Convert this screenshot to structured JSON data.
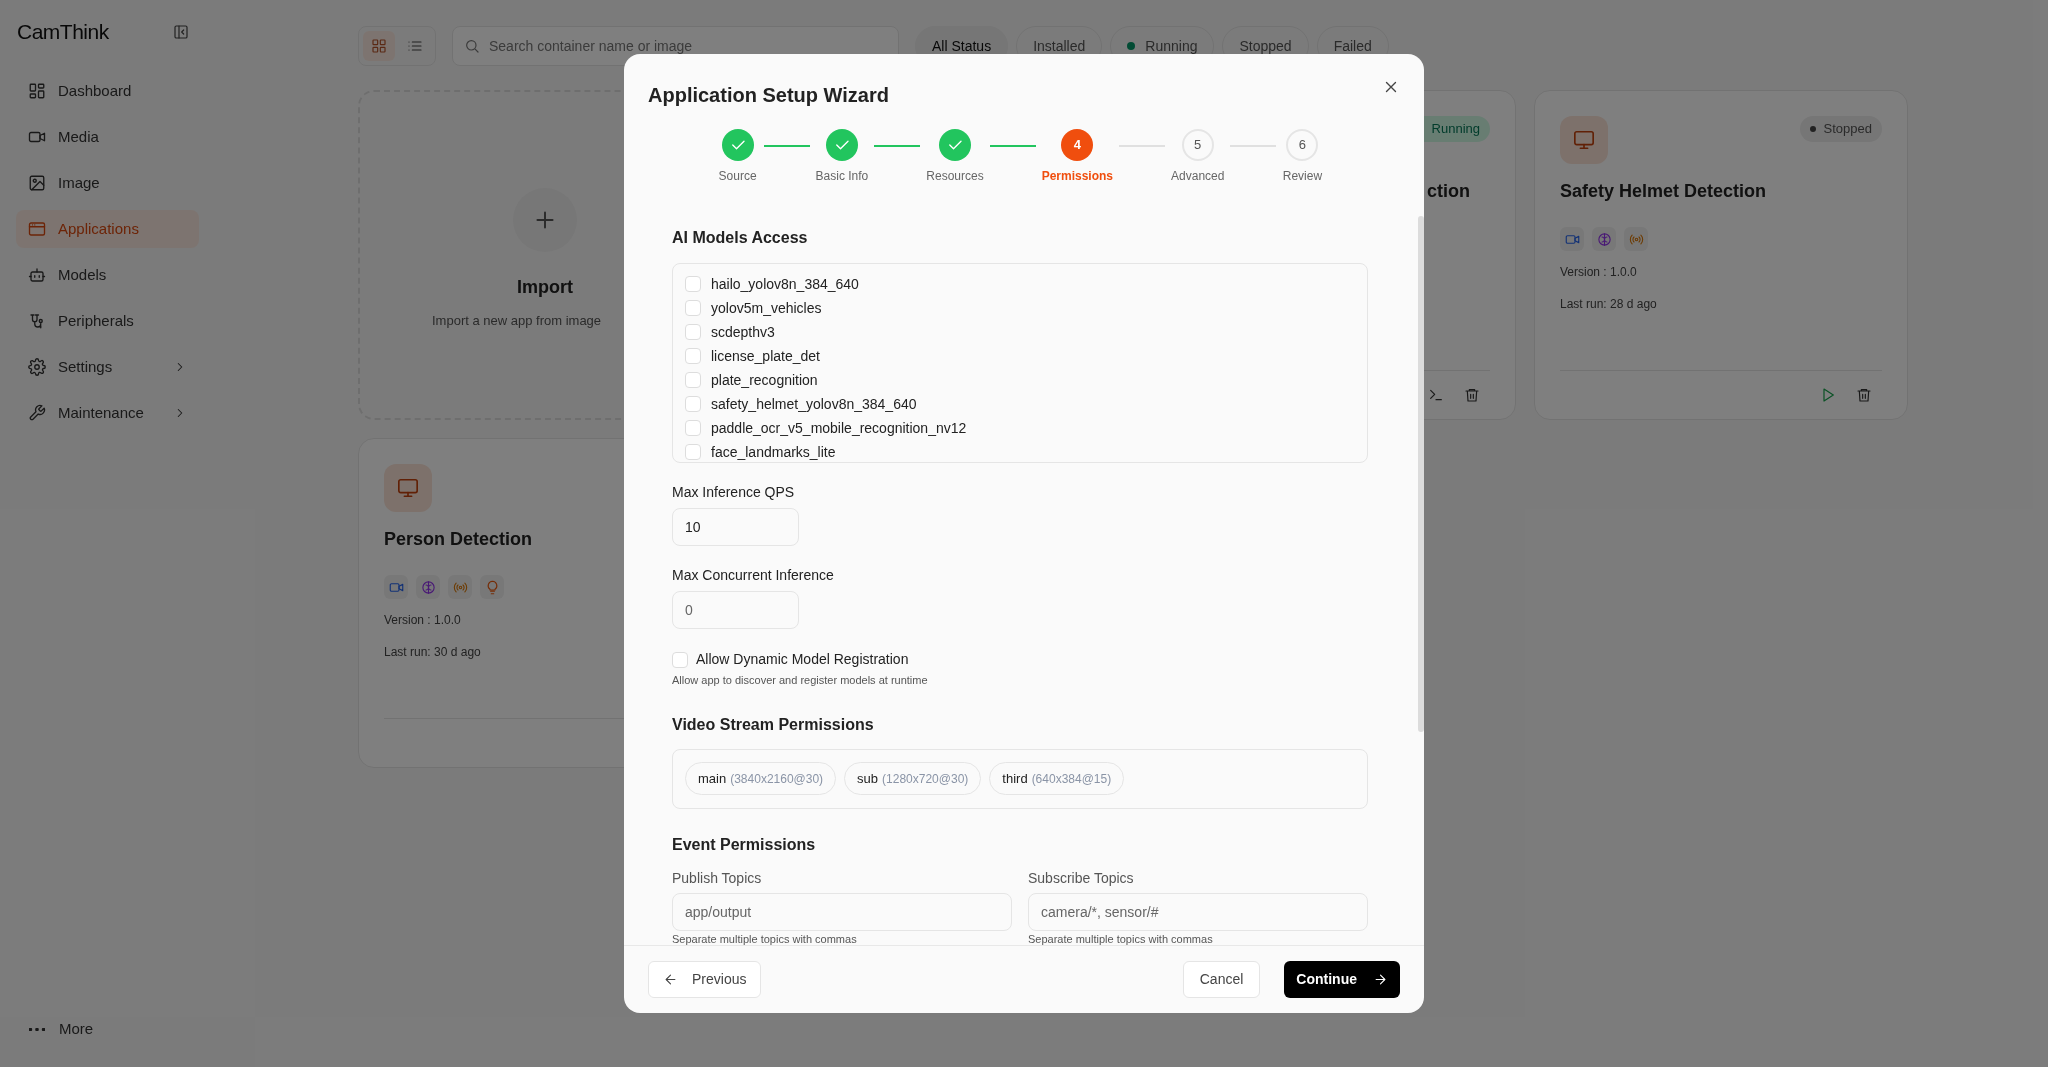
{
  "brand": {
    "name": "CamThink"
  },
  "sidebar": {
    "items": [
      {
        "label": "Dashboard",
        "selected": false,
        "has_submenu": false
      },
      {
        "label": "Media",
        "selected": false,
        "has_submenu": false
      },
      {
        "label": "Image",
        "selected": false,
        "has_submenu": false
      },
      {
        "label": "Applications",
        "selected": true,
        "has_submenu": false
      },
      {
        "label": "Models",
        "selected": false,
        "has_submenu": false
      },
      {
        "label": "Peripherals",
        "selected": false,
        "has_submenu": false
      },
      {
        "label": "Settings",
        "selected": false,
        "has_submenu": true
      },
      {
        "label": "Maintenance",
        "selected": false,
        "has_submenu": true
      }
    ],
    "footer": {
      "label": "More"
    }
  },
  "toolbar": {
    "view_modes": [
      {
        "selected": true
      },
      {
        "selected": false
      }
    ],
    "search": {
      "placeholder": "Search container name or image"
    },
    "status_filters": [
      {
        "label": "All Status",
        "selected": true
      },
      {
        "label": "Installed",
        "selected": false
      },
      {
        "label": "Running",
        "selected": false,
        "has_dot": true
      },
      {
        "label": "Stopped",
        "selected": false
      },
      {
        "label": "Failed",
        "selected": false
      }
    ]
  },
  "import_card": {
    "title": "Import",
    "subtitle": "Import a new app from image"
  },
  "app_cards": [
    {
      "title": "ction",
      "status": "Running",
      "active": true,
      "partial": true
    },
    {
      "title": "Safety Helmet Detection",
      "status": "Stopped",
      "active": false,
      "partial": false,
      "version": "Version : 1.0.0",
      "last_run": "Last run: 28 d ago"
    },
    {
      "title": "Person Detection",
      "partial": false,
      "version": "Version : 1.0.0",
      "last_run": "Last run: 30 d ago"
    }
  ],
  "dialog": {
    "title": "Application Setup Wizard",
    "steps": [
      {
        "label": "Source",
        "completed": true,
        "selected": false
      },
      {
        "label": "Basic Info",
        "completed": true,
        "selected": false
      },
      {
        "label": "Resources",
        "completed": true,
        "selected": false
      },
      {
        "label": "Permissions",
        "number": "4",
        "completed": false,
        "selected": true
      },
      {
        "label": "Advanced",
        "number": "5",
        "completed": false,
        "selected": false
      },
      {
        "label": "Review",
        "number": "6",
        "completed": false,
        "selected": false
      }
    ],
    "models_section": {
      "title": "AI Models Access",
      "models": [
        {
          "label": "hailo_yolov8n_384_640",
          "checked": false
        },
        {
          "label": "yolov5m_vehicles",
          "checked": false
        },
        {
          "label": "scdepthv3",
          "checked": false
        },
        {
          "label": "license_plate_det",
          "checked": false
        },
        {
          "label": "plate_recognition",
          "checked": false
        },
        {
          "label": "safety_helmet_yolov8n_384_640",
          "checked": false
        },
        {
          "label": "paddle_ocr_v5_mobile_recognition_nv12",
          "checked": false
        },
        {
          "label": "face_landmarks_lite",
          "checked": false
        }
      ]
    },
    "max_qps": {
      "label": "Max Inference QPS",
      "value": "10"
    },
    "max_concurrent": {
      "label": "Max Concurrent Inference",
      "placeholder": "0"
    },
    "dynamic_registration": {
      "label": "Allow Dynamic Model Registration",
      "hint": "Allow app to discover and register models at runtime",
      "checked": false
    },
    "video_section": {
      "title": "Video Stream Permissions",
      "streams": [
        {
          "name": "main",
          "spec": "(3840x2160@30)"
        },
        {
          "name": "sub",
          "spec": "(1280x720@30)"
        },
        {
          "name": "third",
          "spec": "(640x384@15)"
        }
      ]
    },
    "event_section": {
      "title": "Event Permissions",
      "publish": {
        "label": "Publish Topics",
        "placeholder": "app/output",
        "hint": "Separate multiple topics with commas"
      },
      "subscribe": {
        "label": "Subscribe Topics",
        "placeholder": "camera/*, sensor/#",
        "hint": "Separate multiple topics with commas"
      }
    },
    "buttons": {
      "previous": "Previous",
      "cancel": "Cancel",
      "continue": "Continue"
    }
  }
}
